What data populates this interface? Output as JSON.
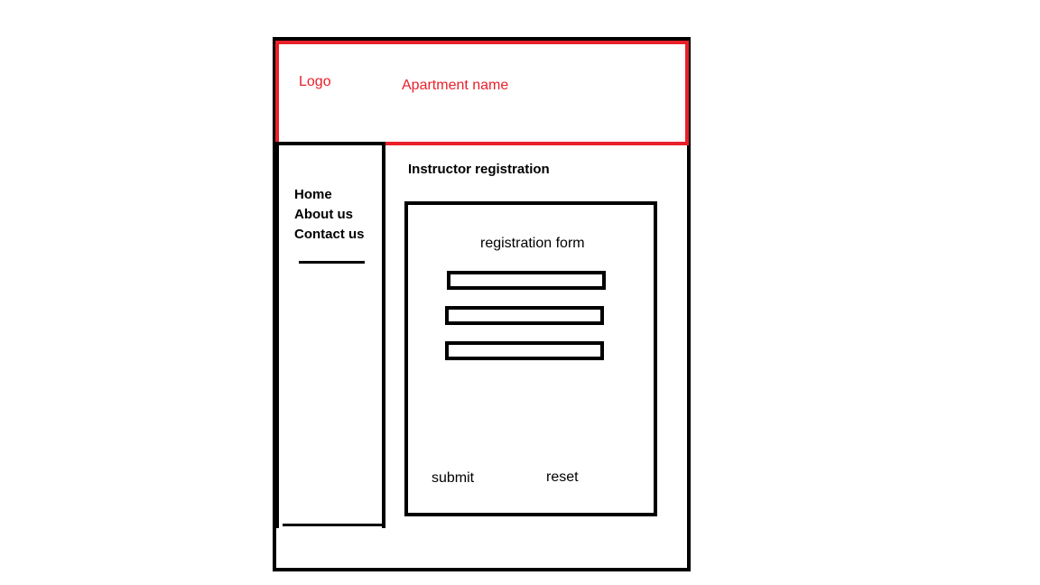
{
  "header": {
    "logo_label": "Logo",
    "apartment_name": "Apartment name"
  },
  "sidebar": {
    "items": [
      {
        "label": "Home"
      },
      {
        "label": "About us"
      },
      {
        "label": "Contact us"
      }
    ]
  },
  "main": {
    "heading": "Instructor registration",
    "form": {
      "title": "registration form",
      "fields": [
        {
          "value": ""
        },
        {
          "value": ""
        },
        {
          "value": ""
        }
      ],
      "submit_label": "submit",
      "reset_label": "reset"
    }
  },
  "colors": {
    "header_border": "#e8202a",
    "header_text": "#e8202a",
    "outline": "#000000"
  }
}
